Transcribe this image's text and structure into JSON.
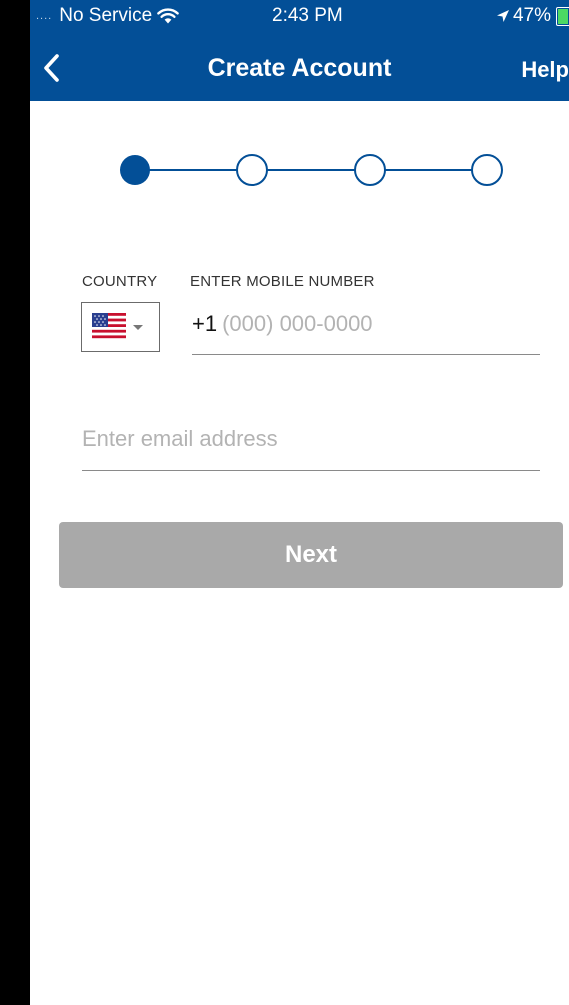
{
  "status_bar": {
    "signal_dots": "....",
    "carrier": "No Service",
    "time": "2:43 PM",
    "battery_percent": "47%",
    "battery_color": "#4cd964"
  },
  "header": {
    "title": "Create Account",
    "help_label": "Help",
    "background_color": "#034f97"
  },
  "stepper": {
    "total_steps": 4,
    "current_step": 1,
    "color": "#034f97"
  },
  "form": {
    "country_label": "COUNTRY",
    "country_flag": "us-flag-icon",
    "mobile_label": "ENTER MOBILE NUMBER",
    "phone_prefix": "+1",
    "phone_placeholder": "(000) 000-0000",
    "email_placeholder": "Enter email address"
  },
  "next_button": {
    "label": "Next",
    "enabled": false,
    "color": "#a9a9a9"
  }
}
